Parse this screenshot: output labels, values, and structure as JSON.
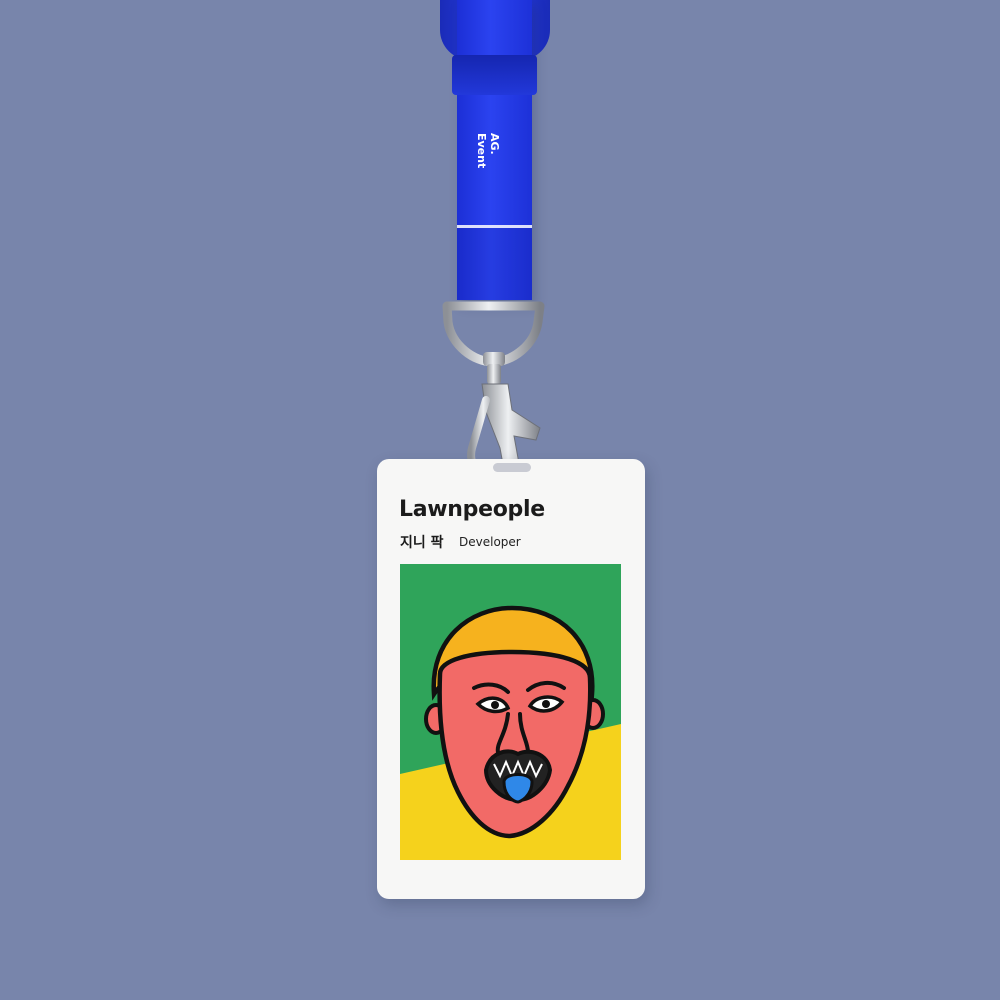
{
  "lanyard": {
    "strap_text_line1": "AG.",
    "strap_text_line2": "Event",
    "strap_color": "#2b43f0"
  },
  "badge": {
    "company": "Lawnpeople",
    "name": "지니 팍",
    "role": "Developer",
    "portrait_colors": {
      "background_top": "#2fa45a",
      "background_bottom": "#f5d21c",
      "hair": "#f6b21e",
      "face": "#f26a67",
      "tongue": "#2f88e8"
    }
  }
}
